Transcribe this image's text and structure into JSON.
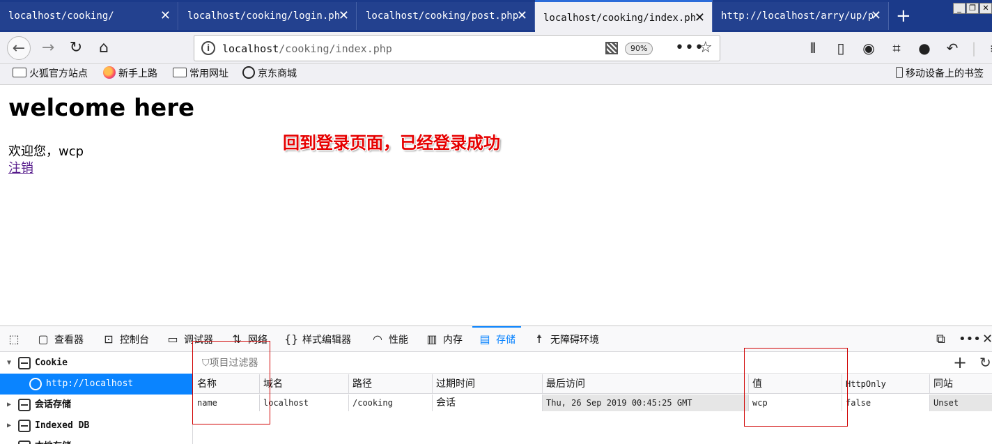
{
  "browser": {
    "tabs": [
      {
        "label": "localhost/cooking/",
        "active": false
      },
      {
        "label": "localhost/cooking/login.ph",
        "active": false
      },
      {
        "label": "localhost/cooking/post.php",
        "active": false
      },
      {
        "label": "localhost/cooking/index.ph",
        "active": true
      },
      {
        "label": "http://localhost/arry/up/p",
        "active": false
      }
    ],
    "tab_close": "✕",
    "new_tab": "+",
    "url_host": "localhost",
    "url_path": "/cooking/index.php",
    "zoom": "90%",
    "bookmarks": [
      "火狐官方站点",
      "新手上路",
      "常用网址",
      "京东商城"
    ],
    "mobile_bookmarks": "移动设备上的书签"
  },
  "page": {
    "title": "welcome here",
    "greeting": "欢迎您，wcp",
    "logout_link": "注销",
    "annotation": "回到登录页面，已经登录成功"
  },
  "devtools": {
    "tabs": [
      "查看器",
      "控制台",
      "调试器",
      "网络",
      "样式编辑器",
      "性能",
      "内存",
      "存储",
      "无障碍环境"
    ],
    "active_tab": "存储",
    "tree": {
      "cookie": "Cookie",
      "cookie_host": "http://localhost",
      "session_storage": "会话存储",
      "indexed_db": "Indexed DB",
      "local_storage": "本地存储"
    },
    "filter_placeholder": "项目过滤器",
    "columns": [
      "名称",
      "域名",
      "路径",
      "过期时间",
      "最后访问",
      "值",
      "HttpOnly",
      "同站"
    ],
    "row": {
      "name": "name",
      "domain": "localhost",
      "path": "/cooking",
      "expires": "会话",
      "last_accessed": "Thu, 26 Sep 2019 00:45:25 GMT",
      "value": "wcp",
      "httponly": "false",
      "samesite": "Unset"
    }
  }
}
